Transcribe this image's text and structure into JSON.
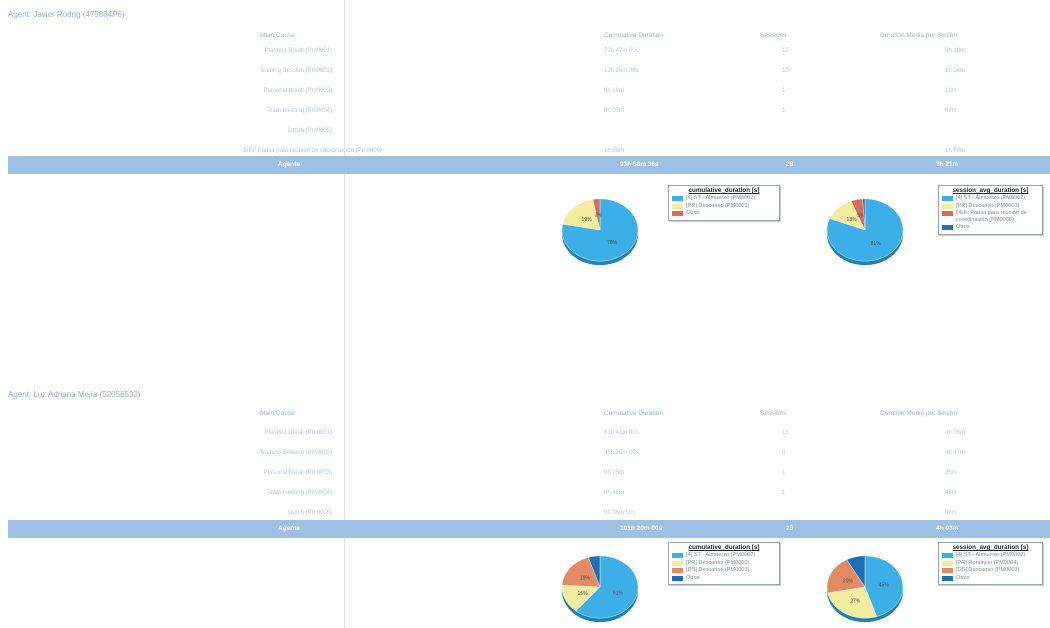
{
  "colors": {
    "blue": "#3dafe8",
    "yellow": "#f1ec9e",
    "red": "#d96b5b",
    "orange": "#e38a63",
    "navy": "#1d6fb8",
    "accent": "#9cc1e2"
  },
  "sections": [
    {
      "title": "Agent: Javier Rodrig (475884P6)",
      "headers": {
        "main": "Main Cause",
        "cumulative": "Cumulative Duration",
        "sessions": "Sessions",
        "avg": "Duration Media por Sesión"
      },
      "rows": [
        {
          "label": "Planned Break (Pm0001)",
          "cumulative": "79h 47m 00s",
          "sessions": "15",
          "avg": "5h 19m"
        },
        {
          "label": "Training Session (Pm0002)",
          "cumulative": "12h 26m 36s",
          "sessions": "10",
          "avg": "1h 14m"
        },
        {
          "label": "Personal break (Pm0003)",
          "cumulative": "0h 18m",
          "sessions": "1",
          "avg": "18m"
        },
        {
          "label": "Team meeting (Pm0004)",
          "cumulative": "0h 07m",
          "sessions": "1",
          "avg": "07m"
        },
        {
          "label": "Lunch (Pm0005)",
          "cumulative": "",
          "sessions": "",
          "avg": ""
        },
        {
          "label": "DEF Pausa para reunión de coordinación (Pm0006)",
          "cumulative": "1h 59m",
          "sessions": "",
          "avg": "1h 59m"
        }
      ],
      "total": {
        "label": "Agente",
        "cumulative": "93h 58m 36s",
        "sessions": "28",
        "avg": "3h 21m"
      },
      "charts": [
        {
          "title": "cumulative_duration [s]",
          "chart_data": {
            "type": "pie",
            "title": "cumulative_duration [s]",
            "labels": [
              "[4] ST - Almuerzo (PM0002)",
              "[PR] Descanso (PM0001)",
              "Otros"
            ],
            "values": [
              78,
              19,
              3
            ],
            "slice_labels": [
              "78%",
              "19%",
              "3%"
            ]
          }
        },
        {
          "title": "session_avg_duration [s]",
          "chart_data": {
            "type": "pie",
            "title": "session_avg_duration [s]",
            "labels": [
              "[4] ST - Almuerzo (PM0002)",
              "[PR] Descanso (PM0001)",
              "DEF: Pausa para reunión de coordinación (PM0006)",
              "Otros"
            ],
            "values": [
              81,
              13,
              5,
              1
            ],
            "slice_labels": [
              "81%",
              "13%",
              "5%",
              ""
            ]
          }
        }
      ]
    },
    {
      "title": "Agent: Luz Adriana Mejía (52056533)",
      "headers": {
        "main": "Main Cause",
        "cumulative": "Cumulative Duration",
        "sessions": "Sessions",
        "avg": "Duration Media por Sesión"
      },
      "rows": [
        {
          "label": "Planned Break (Pm0001)",
          "cumulative": "61h 41m 00s",
          "sessions": "15",
          "avg": "4h 06m"
        },
        {
          "label": "Training Session (Pm0002)",
          "cumulative": "38h 20m 00s",
          "sessions": "8",
          "avg": "4h 47m"
        },
        {
          "label": "Personal break (Pm0003)",
          "cumulative": "0h 25m",
          "sessions": "1",
          "avg": "25m"
        },
        {
          "label": "Team meeting (Pm0004)",
          "cumulative": "0h 48m",
          "sessions": "1",
          "avg": "48m"
        },
        {
          "label": "Lunch (Pm0005)",
          "cumulative": "0h 06m 00s",
          "sessions": "",
          "avg": "06m"
        }
      ],
      "total": {
        "label": "Agente",
        "cumulative": "101h 20m 00s",
        "sessions": "25",
        "avg": "4h 03m"
      },
      "charts": [
        {
          "title": "cumulative_duration [s]",
          "chart_data": {
            "type": "pie",
            "title": "cumulative_duration [s]",
            "labels": [
              "[4] ST - Almuerzo (PM0002)",
              "[PR] Descanso (PM0001)",
              "[DS] Descanso (PM0003)",
              "Otros"
            ],
            "values": [
              61,
              15,
              19,
              5
            ],
            "slice_labels": [
              "61%",
              "15%",
              "19%",
              ""
            ]
          }
        },
        {
          "title": "session_avg_duration [s]",
          "chart_data": {
            "type": "pie",
            "title": "session_avg_duration [s]",
            "labels": [
              "[4] ST - Almuerzo (PM0002)",
              "[PR] Renuncio (PM0004)",
              "[DS] Descanso (PM0003)",
              "Otros"
            ],
            "values": [
              45,
              27,
              20,
              8
            ],
            "slice_labels": [
              "45%",
              "27%",
              "20%",
              ""
            ]
          }
        }
      ]
    }
  ]
}
